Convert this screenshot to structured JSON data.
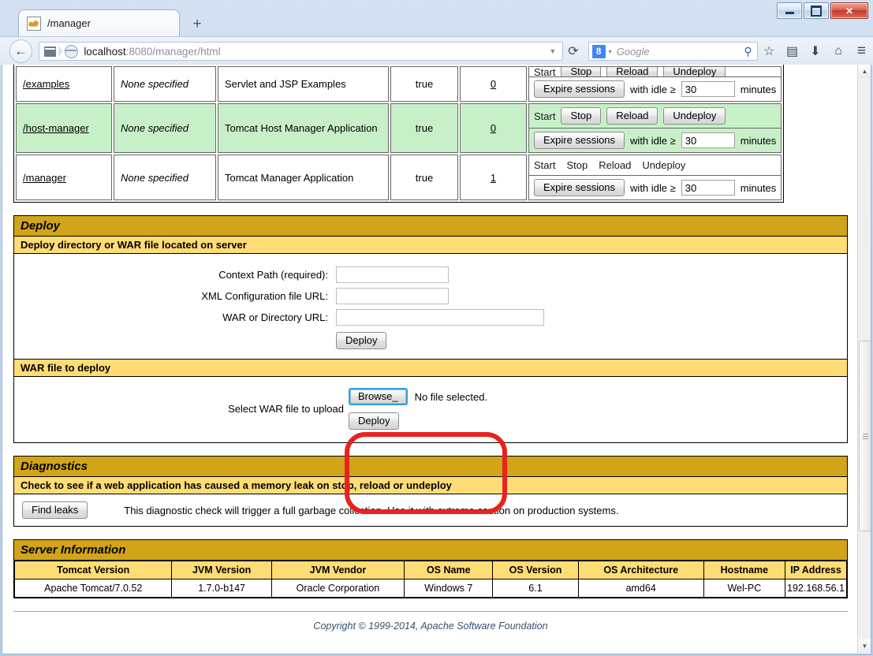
{
  "window": {
    "controls": {
      "minimize": "minimize",
      "maximize": "maximize",
      "close": "✕"
    }
  },
  "browser": {
    "tab": {
      "title": "/manager",
      "favicon": "tomcat-favicon"
    },
    "new_tab_label": "+",
    "back_label": "←",
    "url": {
      "host": "localhost",
      "rest": ":8080/manager/html",
      "dropdown": "▼"
    },
    "reload_label": "⟳",
    "search": {
      "engine": "Google",
      "logo_letter": "8",
      "caret": "▾",
      "magnifier": "⚲"
    },
    "toolbar_icons": [
      "bookmark-star-icon",
      "reading-list-icon",
      "downloads-icon",
      "home-icon",
      "menu-icon"
    ],
    "toolbar_glyphs": [
      "☆",
      "▤",
      "⬇",
      "⌂",
      "≡"
    ]
  },
  "apps_table": {
    "rows": [
      {
        "path": "/examples",
        "version": "None specified",
        "display_name": "Servlet and JSP Examples",
        "running": "true",
        "sessions": "0",
        "highlight": false,
        "commands_enabled": true,
        "commands": [
          "Start",
          "Stop",
          "Reload",
          "Undeploy"
        ],
        "expire_label": "Expire sessions",
        "idle_prefix": "with idle ≥",
        "idle_value": "30",
        "idle_suffix": "minutes",
        "clipped": true
      },
      {
        "path": "/host-manager",
        "version": "None specified",
        "display_name": "Tomcat Host Manager Application",
        "running": "true",
        "sessions": "0",
        "highlight": true,
        "commands_enabled": true,
        "commands": [
          "Start",
          "Stop",
          "Reload",
          "Undeploy"
        ],
        "expire_label": "Expire sessions",
        "idle_prefix": "with idle ≥",
        "idle_value": "30",
        "idle_suffix": "minutes",
        "clipped": false
      },
      {
        "path": "/manager",
        "version": "None specified",
        "display_name": "Tomcat Manager Application",
        "running": "true",
        "sessions": "1",
        "highlight": false,
        "commands_enabled": false,
        "commands": [
          "Start",
          "Stop",
          "Reload",
          "Undeploy"
        ],
        "expire_label": "Expire sessions",
        "idle_prefix": "with idle ≥",
        "idle_value": "30",
        "idle_suffix": "minutes",
        "clipped": false
      }
    ]
  },
  "deploy": {
    "title": "Deploy",
    "server_section": {
      "subtitle": "Deploy directory or WAR file located on server",
      "fields": [
        {
          "label": "Context Path (required):",
          "value": "",
          "size": "sm"
        },
        {
          "label": "XML Configuration file URL:",
          "value": "",
          "size": "sm"
        },
        {
          "label": "WAR or Directory URL:",
          "value": "",
          "size": "lg"
        }
      ],
      "deploy_button": "Deploy"
    },
    "war_section": {
      "subtitle": "WAR file to deploy",
      "label": "Select WAR file to upload",
      "browse_button": "Browse_",
      "file_status": "No file selected.",
      "deploy_button": "Deploy"
    }
  },
  "diagnostics": {
    "title": "Diagnostics",
    "subtitle": "Check to see if a web application has caused a memory leak on stop, reload or undeploy",
    "find_leaks_button": "Find leaks",
    "description": "This diagnostic check will trigger a full garbage collection. Use it with extreme caution on production systems."
  },
  "server_information": {
    "title": "Server Information",
    "headers": [
      "Tomcat Version",
      "JVM Version",
      "JVM Vendor",
      "OS Name",
      "OS Version",
      "OS Architecture",
      "Hostname",
      "IP Address"
    ],
    "values": [
      "Apache Tomcat/7.0.52",
      "1.7.0-b147",
      "Oracle Corporation",
      "Windows 7",
      "6.1",
      "amd64",
      "Wel-PC",
      "192.168.56.1"
    ]
  },
  "footer": {
    "copyright": "Copyright © 1999-2014, Apache Software Foundation"
  },
  "annotation": {
    "shape": "red-ellipse-highlight",
    "color": "#E8231F"
  },
  "colors": {
    "panel_title_gold": "#D1A41A",
    "panel_sub_gold": "#FFDC75",
    "row_highlight_green": "#C8F0C8",
    "annotation_red": "#E8231F"
  }
}
